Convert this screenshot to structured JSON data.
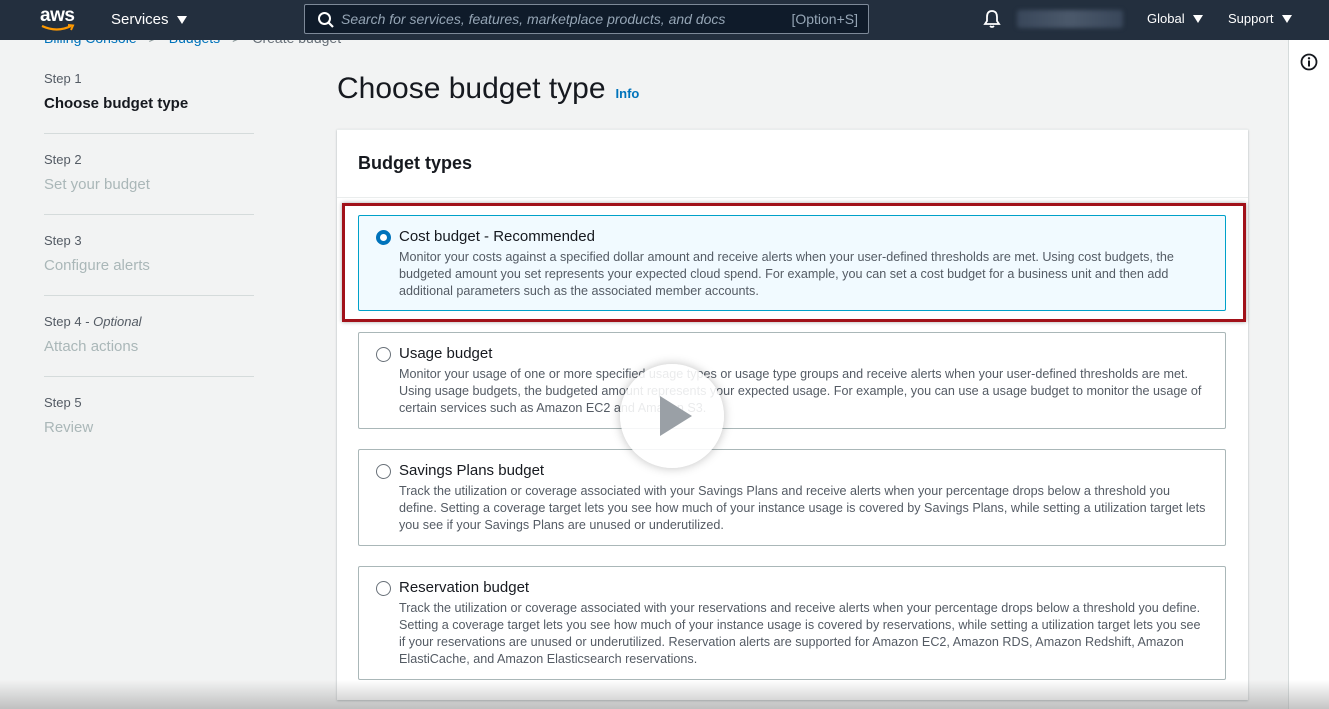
{
  "nav": {
    "logo_text": "aws",
    "services_label": "Services",
    "search_placeholder": "Search for services, features, marketplace products, and docs",
    "search_shortcut": "[Option+S]",
    "region_label": "Global",
    "support_label": "Support"
  },
  "breadcrumb": {
    "items": [
      "Billing Console",
      "Budgets",
      "Create budget"
    ]
  },
  "steps": [
    {
      "num": "Step 1",
      "optional": "",
      "title": "Choose budget type",
      "active": true
    },
    {
      "num": "Step 2",
      "optional": "",
      "title": "Set your budget",
      "active": false
    },
    {
      "num": "Step 3",
      "optional": "",
      "title": "Configure alerts",
      "active": false
    },
    {
      "num": "Step 4 - ",
      "optional": "Optional",
      "title": "Attach actions",
      "active": false
    },
    {
      "num": "Step 5",
      "optional": "",
      "title": "Review",
      "active": false
    }
  ],
  "main": {
    "title": "Choose budget type",
    "info_label": "Info",
    "panel_heading": "Budget types",
    "options": [
      {
        "title": "Cost budget - Recommended",
        "description": "Monitor your costs against a specified dollar amount and receive alerts when your user-defined thresholds are met. Using cost budgets, the budgeted amount you set represents your expected cloud spend. For example, you can set a cost budget for a business unit and then add additional parameters such as the associated member accounts.",
        "selected": true
      },
      {
        "title": "Usage budget",
        "description": "Monitor your usage of one or more specified usage types or usage type groups and receive alerts when your user-defined thresholds are met. Using usage budgets, the budgeted amount represents your expected usage. For example, you can use a usage budget to monitor the usage of certain services such as Amazon EC2 and Amazon S3.",
        "selected": false
      },
      {
        "title": "Savings Plans budget",
        "description": "Track the utilization or coverage associated with your Savings Plans and receive alerts when your percentage drops below a threshold you define. Setting a coverage target lets you see how much of your instance usage is covered by Savings Plans, while setting a utilization target lets you see if your Savings Plans are unused or underutilized.",
        "selected": false
      },
      {
        "title": "Reservation budget",
        "description": "Track the utilization or coverage associated with your reservations and receive alerts when your percentage drops below a threshold you define. Setting a coverage target lets you see how much of your instance usage is covered by reservations, while setting a utilization target lets you see if your reservations are unused or underutilized. Reservation alerts are supported for Amazon EC2, Amazon RDS, Amazon Redshift, Amazon ElastiCache, and Amazon Elasticsearch reservations.",
        "selected": false
      }
    ]
  },
  "icons": {
    "search": "search-icon",
    "bell": "bell-icon",
    "info": "info-icon",
    "play": "play-icon"
  },
  "colors": {
    "nav_bg": "#232f3e",
    "link": "#0073bb",
    "selected_bg": "#f1faff",
    "selected_border": "#00a1c9",
    "highlight": "#a11119"
  }
}
